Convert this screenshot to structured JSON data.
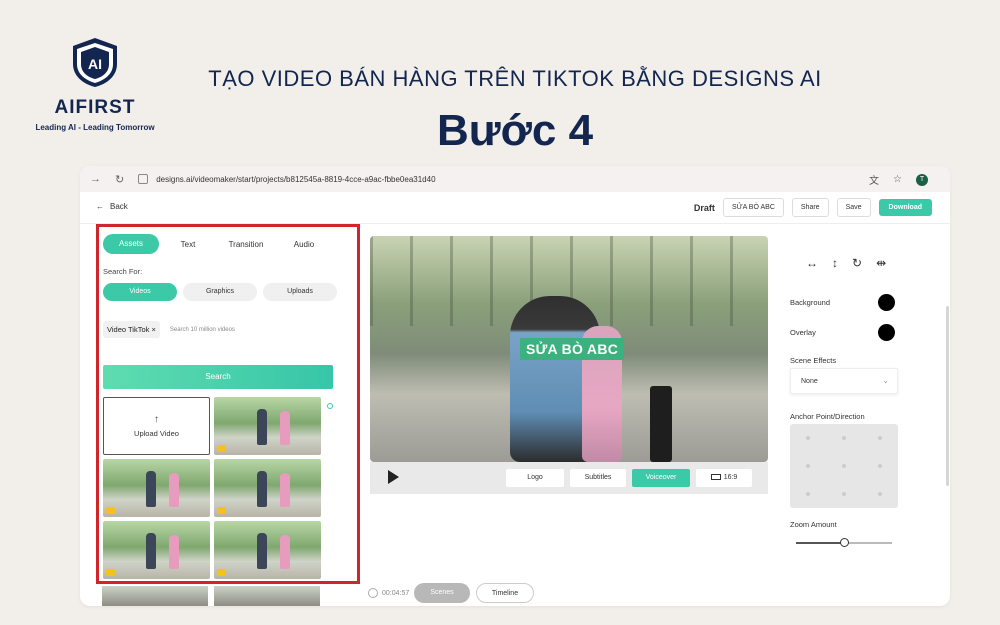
{
  "brand": {
    "name": "AIFIRST",
    "shield_text": "AI",
    "tagline": "Leading AI - Leading Tomorrow"
  },
  "hero": {
    "title": "TẠO VIDEO BÁN HÀNG TRÊN TIKTOK BẰNG DESIGNS AI",
    "step": "Bước 4"
  },
  "browser": {
    "url": "designs.ai/videomaker/start/projects/b812545a-8819-4cce-a9ac-fbbe0ea31d40",
    "avatar_letter": "T"
  },
  "toolbar": {
    "back_label": "Back",
    "draft_label": "Draft",
    "project_name": "SỬA BÒ ABC",
    "share_label": "Share",
    "save_label": "Save",
    "download_label": "Download"
  },
  "left_panel": {
    "tabs": [
      {
        "label": "Assets",
        "active": true
      },
      {
        "label": "Text",
        "active": false
      },
      {
        "label": "Transition",
        "active": false
      },
      {
        "label": "Audio",
        "active": false
      }
    ],
    "search_for_label": "Search For:",
    "chips": [
      {
        "label": "Videos",
        "active": true
      },
      {
        "label": "Graphics",
        "active": false
      },
      {
        "label": "Uploads",
        "active": false
      }
    ],
    "search_tag": "Video TikTok",
    "search_placeholder": "Search 10 million videos",
    "search_button": "Search",
    "upload_label": "Upload Video"
  },
  "video": {
    "caption": "SỬA BÒ ABC",
    "controls": {
      "logo": "Logo",
      "subtitles": "Subtitles",
      "voiceover": "Voiceover",
      "ratio": "16:9"
    }
  },
  "timeline": {
    "timecode": "00:04:57",
    "scenes_label": "Scenes",
    "timeline_label": "Timeline"
  },
  "right_panel": {
    "background_label": "Background",
    "background_color": "#000000",
    "overlay_label": "Overlay",
    "overlay_color": "#000000",
    "scene_effects_label": "Scene Effects",
    "scene_effects_value": "None",
    "anchor_label": "Anchor Point/Direction",
    "zoom_label": "Zoom Amount",
    "zoom_value": 0.5
  },
  "colors": {
    "accent": "#3bc9a8",
    "brand_navy": "#13264f",
    "highlight_border": "#d0252a"
  }
}
